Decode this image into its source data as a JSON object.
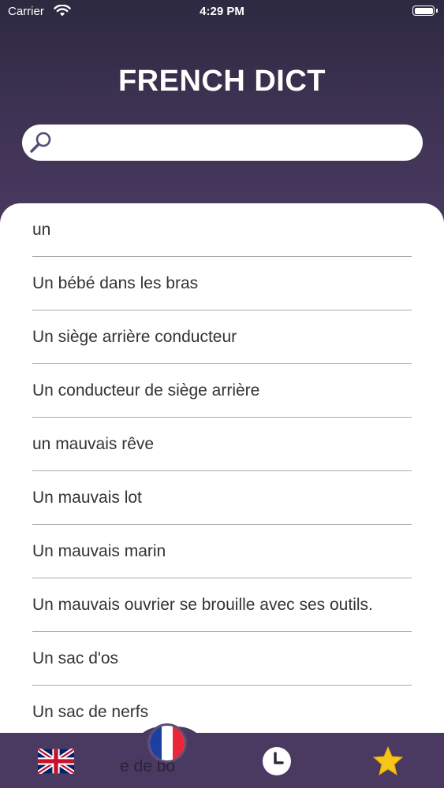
{
  "status_bar": {
    "carrier": "Carrier",
    "time": "4:29 PM"
  },
  "header": {
    "title": "FRENCH DICT"
  },
  "search": {
    "value": "",
    "placeholder": ""
  },
  "word_list": [
    "un",
    "Un bébé dans les bras",
    "Un siège arrière conducteur",
    "Un conducteur de siège arrière",
    "un mauvais rêve",
    "Un mauvais lot",
    "Un mauvais marin",
    "Un mauvais ouvrier se brouille avec ses outils.",
    "Un sac d'os",
    "Un sac de nerfs"
  ],
  "tab_bar": {
    "partial_row_text": "e de bo",
    "tabs": [
      {
        "icon": "uk-flag-icon"
      },
      {
        "icon": "france-flag-icon"
      },
      {
        "icon": "clock-icon"
      },
      {
        "icon": "star-icon"
      }
    ]
  },
  "colors": {
    "header_top": "#2d2940",
    "header_bottom": "#4a3a62",
    "tab_bar": "#4a3a62",
    "star": "#f5c518",
    "search_icon": "#5a4a7a"
  }
}
